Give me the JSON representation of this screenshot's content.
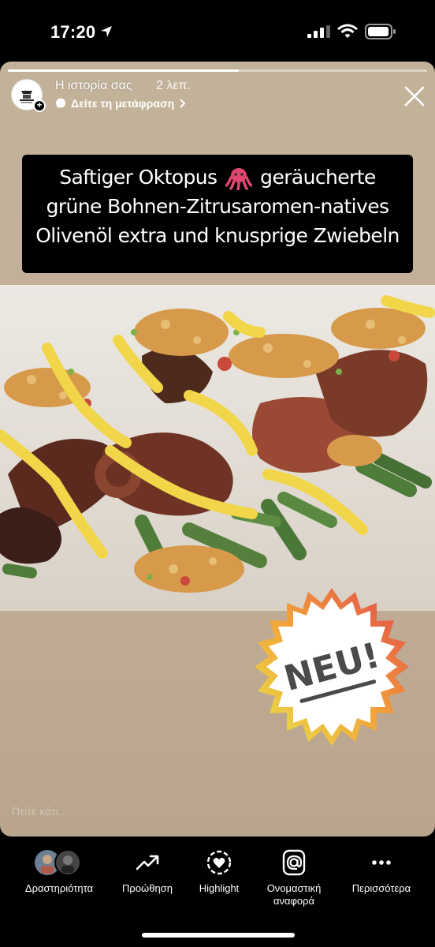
{
  "status_bar": {
    "time": "17:20"
  },
  "story": {
    "progress": 0.55,
    "title": "Η ιστορία σας",
    "time_ago": "2 λεπ.",
    "translate_label": "Δείτε τη μετάφραση",
    "caption_lines": [
      "Saftiger Oktopus",
      "geräucherte",
      "grüne Bohnen-Zitrusaromen-natives",
      "Olivenöl extra und knusprige Zwiebeln"
    ],
    "badge_text": "NEU!",
    "reply_placeholder": "Πείτε κάτι..."
  },
  "bottom_actions": [
    {
      "label": "Δραστηριότητα",
      "icon": "activity-avatars-icon"
    },
    {
      "label": "Προώθηση",
      "icon": "trending-up-icon"
    },
    {
      "label": "Highlight",
      "icon": "highlight-heart-icon"
    },
    {
      "label": "Ονομαστική αναφορά",
      "icon": "at-sign-icon"
    },
    {
      "label": "Περισσότερα",
      "icon": "more-dots-icon"
    }
  ],
  "colors": {
    "story_bg": "#c2b099",
    "sauce_yellow": "#f2d64a",
    "bean_green": "#4e7d3a",
    "octopus_brown": "#7a3a28"
  }
}
